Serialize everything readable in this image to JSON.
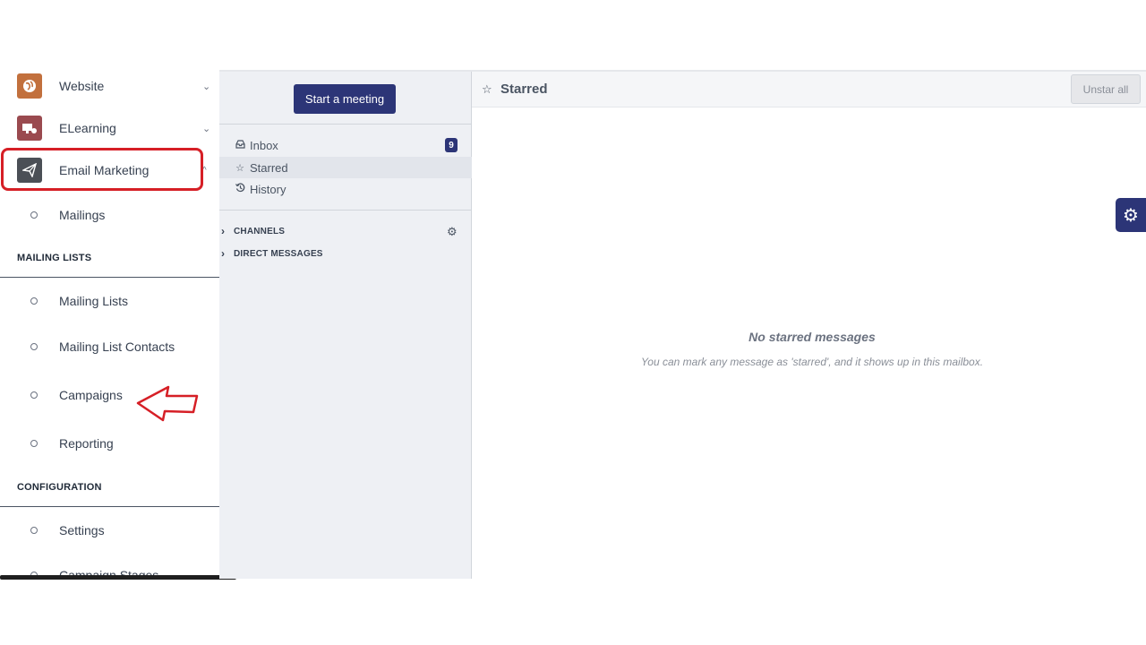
{
  "sidebar": {
    "apps": [
      {
        "label": "Website",
        "icon": "website-icon",
        "color": "#c2703d"
      },
      {
        "label": "ELearning",
        "icon": "elearning-icon",
        "color": "#9a4a4f"
      },
      {
        "label": "Email Marketing",
        "icon": "paper-plane-icon",
        "color": "#4b4f56"
      }
    ],
    "email_sub": [
      {
        "label": "Mailings"
      }
    ],
    "mailing_lists_header": "MAILING LISTS",
    "mailing_lists": [
      {
        "label": "Mailing Lists"
      },
      {
        "label": "Mailing List Contacts"
      },
      {
        "label": "Campaigns"
      },
      {
        "label": "Reporting"
      }
    ],
    "configuration_header": "CONFIGURATION",
    "configuration": [
      {
        "label": "Settings"
      },
      {
        "label": "Campaign Stages"
      }
    ]
  },
  "discuss": {
    "start_meeting": "Start a meeting",
    "mailboxes": [
      {
        "label": "Inbox",
        "icon": "inbox-icon",
        "count": "9"
      },
      {
        "label": "Starred",
        "icon": "star-icon"
      },
      {
        "label": "History",
        "icon": "history-icon"
      }
    ],
    "categories": [
      {
        "label": "CHANNELS"
      },
      {
        "label": "DIRECT MESSAGES"
      }
    ]
  },
  "thread": {
    "title": "Starred",
    "unstar_all": "Unstar all",
    "empty_title": "No starred messages",
    "empty_subtitle": "You can mark any message as 'starred', and it shows up in this mailbox."
  },
  "colors": {
    "accent": "#2c3577",
    "highlight": "#d61f26"
  }
}
